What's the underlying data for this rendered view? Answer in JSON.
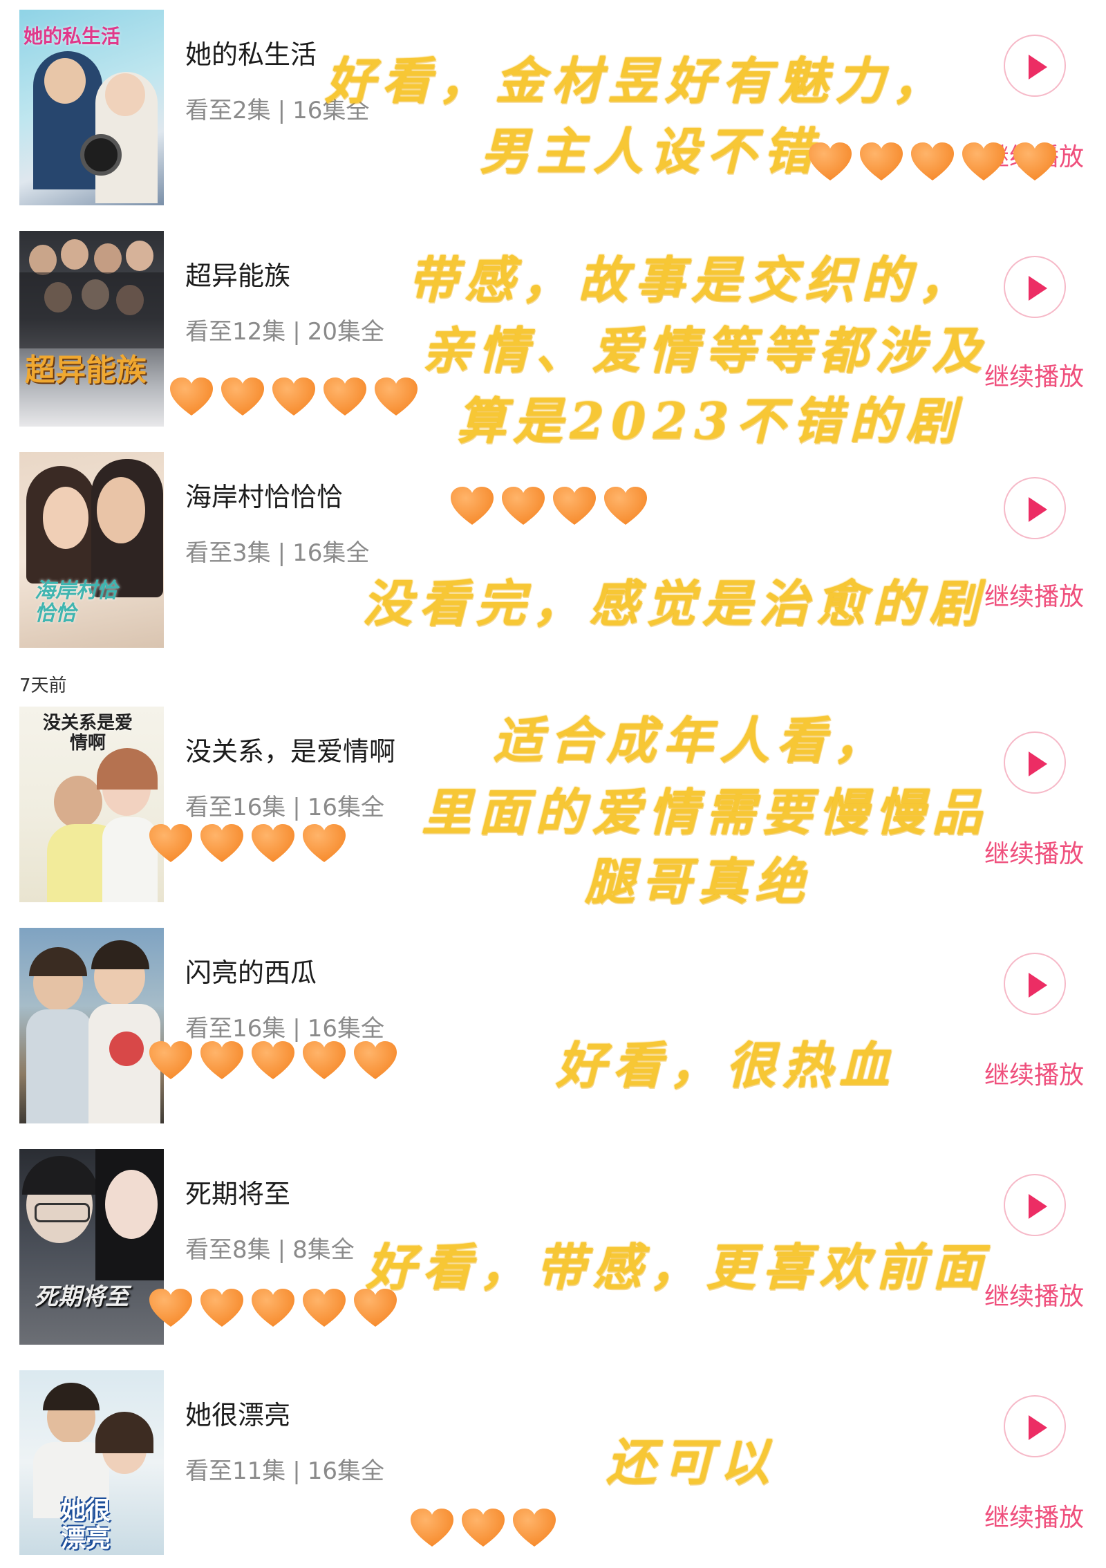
{
  "continue_label": "继续播放",
  "section_label": "7天前",
  "colors": {
    "accent": "#ec2d64",
    "heart": "#f6892a",
    "handwriting": "#f7c735"
  },
  "items": [
    {
      "poster_text": "她的私生活",
      "title": "她的私生活",
      "watched": "看至2集",
      "total": "16集全",
      "hearts": 5,
      "note_lines": [
        "好看，金材昱好有魅力，",
        "男主人设不错"
      ]
    },
    {
      "poster_text": "超异能族",
      "title": "超异能族",
      "watched": "看至12集",
      "total": "20集全",
      "hearts": 5,
      "note_lines": [
        "带感，故事是交织的，",
        "亲情、爱情等等都涉及",
        "算是2023不错的剧"
      ]
    },
    {
      "poster_text": "海岸村恰恰恰",
      "title": "海岸村恰恰恰",
      "watched": "看至3集",
      "total": "16集全",
      "hearts": 4,
      "note_lines": [
        "没看完，感觉是治愈的剧"
      ]
    },
    {
      "poster_text": "没关系是爱情啊",
      "title": "没关系，是爱情啊",
      "watched": "看至16集",
      "total": "16集全",
      "hearts": 4,
      "note_lines": [
        "适合成年人看，",
        "里面的爱情需要慢慢品",
        "腿哥真绝"
      ]
    },
    {
      "poster_text": "",
      "title": "闪亮的西瓜",
      "watched": "看至16集",
      "total": "16集全",
      "hearts": 5,
      "note_lines": [
        "好看，很热血"
      ]
    },
    {
      "poster_text": "死期将至",
      "title": "死期将至",
      "watched": "看至8集",
      "total": "8集全",
      "hearts": 5,
      "note_lines": [
        "好看，带感，更喜欢前面"
      ]
    },
    {
      "poster_text": "她很漂亮",
      "title": "她很漂亮",
      "watched": "看至11集",
      "total": "16集全",
      "hearts": 3,
      "note_lines": [
        "还可以"
      ]
    }
  ]
}
